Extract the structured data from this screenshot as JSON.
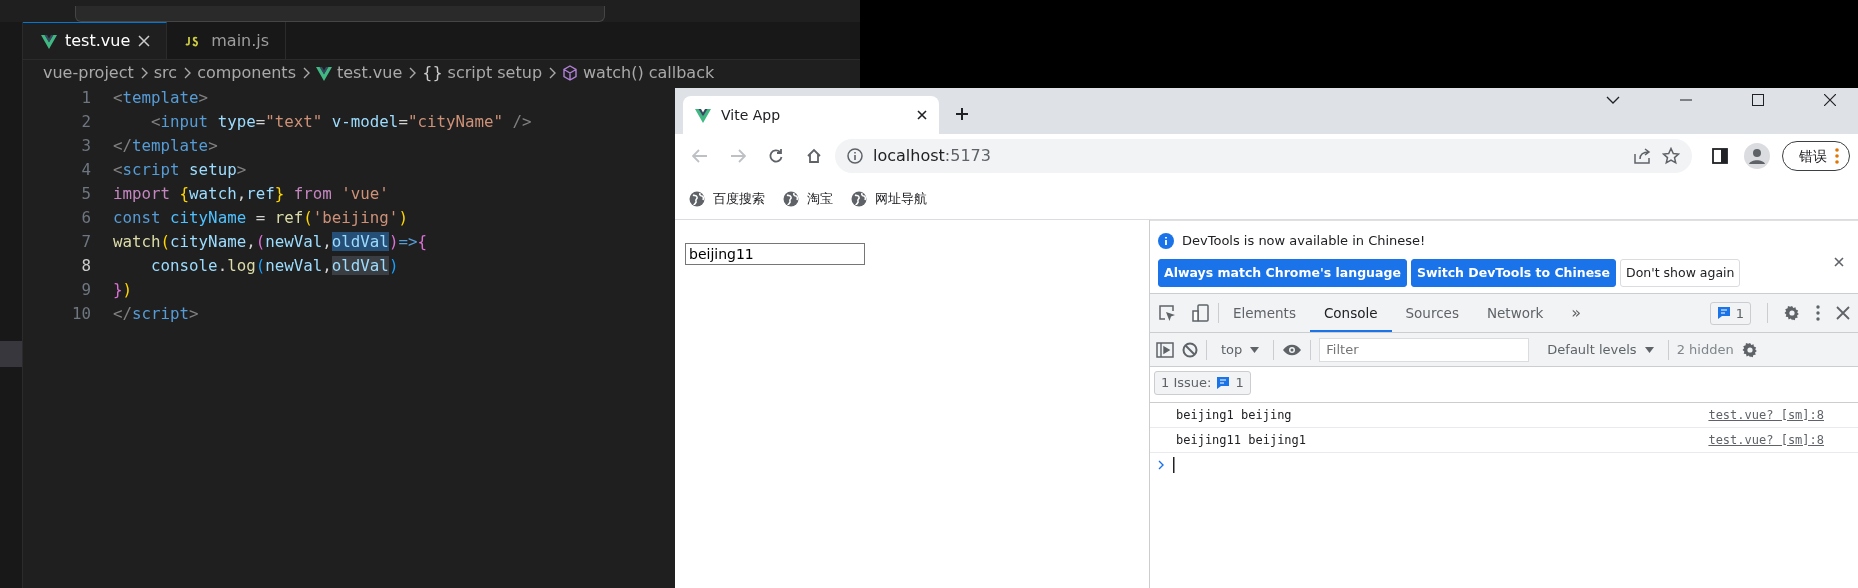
{
  "vscode": {
    "tabs": [
      {
        "label": "test.vue",
        "kind": "vue",
        "selected": true
      },
      {
        "label": "main.js",
        "kind": "js",
        "selected": false
      }
    ],
    "breadcrumb": [
      {
        "label": "vue-project",
        "kind": "folder"
      },
      {
        "label": "src",
        "kind": "folder"
      },
      {
        "label": "components",
        "kind": "folder"
      },
      {
        "label": "test.vue",
        "kind": "vue"
      },
      {
        "label": "script setup",
        "kind": "braces",
        "icon": "{}"
      },
      {
        "label": "watch() callback",
        "kind": "function"
      }
    ],
    "lines": [
      {
        "number": "1",
        "current": false,
        "tokens": [
          {
            "text": "<",
            "kind": "punct"
          },
          {
            "text": "template",
            "kind": "tag"
          },
          {
            "text": ">",
            "kind": "punct"
          }
        ]
      },
      {
        "number": "2",
        "current": false,
        "tokens": [
          {
            "text": "    <",
            "kind": "punct"
          },
          {
            "text": "input",
            "kind": "tag"
          },
          {
            "text": " type",
            "kind": "attr"
          },
          {
            "text": "=",
            "kind": "op"
          },
          {
            "text": "\"text\"",
            "kind": "string"
          },
          {
            "text": " v-model",
            "kind": "attr"
          },
          {
            "text": "=",
            "kind": "op"
          },
          {
            "text": "\"cityName\"",
            "kind": "string"
          },
          {
            "text": " />",
            "kind": "punct"
          }
        ]
      },
      {
        "number": "3",
        "current": false,
        "tokens": [
          {
            "text": "</",
            "kind": "punct"
          },
          {
            "text": "template",
            "kind": "tag"
          },
          {
            "text": ">",
            "kind": "punct"
          }
        ]
      },
      {
        "number": "4",
        "current": false,
        "tokens": [
          {
            "text": "<",
            "kind": "punct"
          },
          {
            "text": "script",
            "kind": "tag"
          },
          {
            "text": " setup",
            "kind": "attr"
          },
          {
            "text": ">",
            "kind": "punct"
          }
        ]
      },
      {
        "number": "5",
        "current": false,
        "tokens": [
          {
            "text": "import ",
            "kind": "keyword"
          },
          {
            "text": "{",
            "kind": "bracket1"
          },
          {
            "text": "watch",
            "kind": "var"
          },
          {
            "text": ",",
            "kind": "op"
          },
          {
            "text": "ref",
            "kind": "var"
          },
          {
            "text": "}",
            "kind": "bracket1"
          },
          {
            "text": " from ",
            "kind": "keyword"
          },
          {
            "text": "'vue'",
            "kind": "string"
          }
        ]
      },
      {
        "number": "6",
        "current": false,
        "tokens": [
          {
            "text": "const ",
            "kind": "storage"
          },
          {
            "text": "cityName",
            "kind": "const"
          },
          {
            "text": " = ",
            "kind": "op"
          },
          {
            "text": "ref",
            "kind": "func"
          },
          {
            "text": "(",
            "kind": "bracket1"
          },
          {
            "text": "'beijing'",
            "kind": "string"
          },
          {
            "text": ")",
            "kind": "bracket1"
          }
        ]
      },
      {
        "number": "7",
        "current": false,
        "tokens": [
          {
            "text": "watch",
            "kind": "func"
          },
          {
            "text": "(",
            "kind": "bracket1"
          },
          {
            "text": "cityName",
            "kind": "var"
          },
          {
            "text": ",",
            "kind": "op"
          },
          {
            "text": "(",
            "kind": "bracket2"
          },
          {
            "text": "newVal",
            "kind": "var"
          },
          {
            "text": ",",
            "kind": "op"
          },
          {
            "text": "oldVal",
            "kind": "var-selected"
          },
          {
            "text": ")",
            "kind": "bracket2"
          },
          {
            "text": "=>",
            "kind": "storage"
          },
          {
            "text": "{",
            "kind": "bracket2"
          }
        ]
      },
      {
        "number": "8",
        "current": true,
        "tokens": [
          {
            "text": "    console",
            "kind": "var"
          },
          {
            "text": ".",
            "kind": "op"
          },
          {
            "text": "log",
            "kind": "func"
          },
          {
            "text": "(",
            "kind": "bracket3"
          },
          {
            "text": "newVal",
            "kind": "var"
          },
          {
            "text": ",",
            "kind": "op"
          },
          {
            "text": "oldVal",
            "kind": "var-match"
          },
          {
            "text": ")",
            "kind": "bracket3"
          }
        ]
      },
      {
        "number": "9",
        "current": false,
        "tokens": [
          {
            "text": "}",
            "kind": "bracket2"
          },
          {
            "text": ")",
            "kind": "bracket1"
          }
        ]
      },
      {
        "number": "10",
        "current": false,
        "tokens": [
          {
            "text": "</",
            "kind": "punct"
          },
          {
            "text": "script",
            "kind": "tag"
          },
          {
            "text": ">",
            "kind": "punct"
          }
        ]
      }
    ]
  },
  "browser": {
    "tab_title": "Vite App",
    "address": {
      "host": "localhost",
      "port": ":5173"
    },
    "profile_button": "错误",
    "bookmarks": [
      "百度搜索",
      "淘宝",
      "网址导航"
    ],
    "page": {
      "input_value": "beijing11"
    },
    "devtools": {
      "infobar": {
        "message": "DevTools is now available in Chinese!",
        "buttons": [
          {
            "label": "Always match Chrome's language",
            "kind": "primary"
          },
          {
            "label": "Switch DevTools to Chinese",
            "kind": "primary"
          },
          {
            "label": "Don't show again",
            "kind": "secondary"
          }
        ]
      },
      "tabs": [
        {
          "label": "Elements",
          "selected": false
        },
        {
          "label": "Console",
          "selected": true
        },
        {
          "label": "Sources",
          "selected": false
        },
        {
          "label": "Network",
          "selected": false
        }
      ],
      "more": "»",
      "issues_count": "1",
      "toolbar": {
        "context": "top",
        "filter_placeholder": "Filter",
        "levels": "Default levels",
        "hidden": "2 hidden"
      },
      "issues": {
        "label": "1 Issue:",
        "count": "1"
      },
      "messages": [
        {
          "text": "beijing1 beijing",
          "source": "test.vue? [sm]:8"
        },
        {
          "text": "beijing11 beijing1",
          "source": "test.vue? [sm]:8"
        }
      ]
    }
  }
}
